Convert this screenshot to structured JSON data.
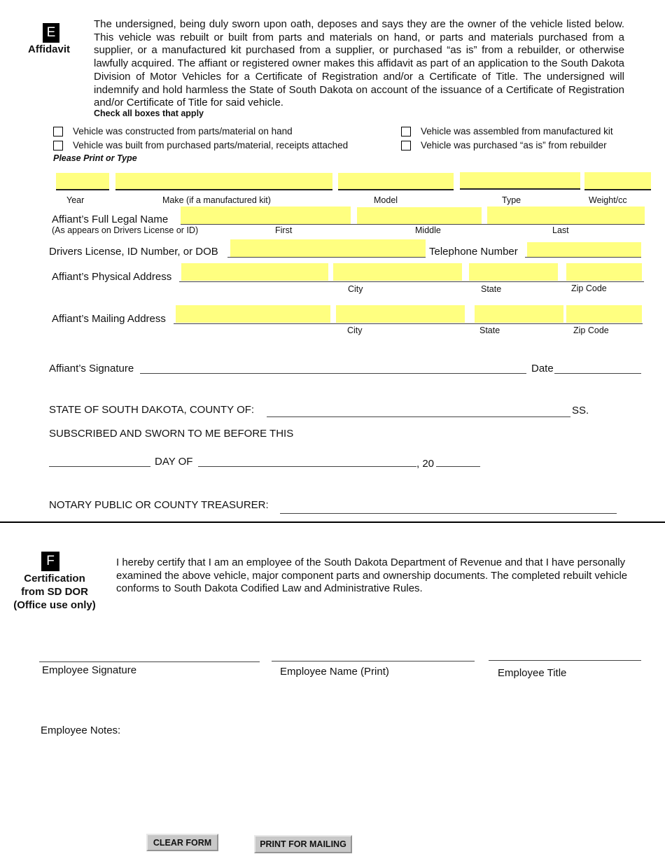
{
  "section_e": {
    "badge": "E",
    "title": "Affidavit",
    "paragraph": "The undersigned, being duly sworn upon oath, deposes and says they are the owner of the vehicle listed below. This vehicle was rebuilt or built from parts and materials on hand, or parts and materials purchased from a supplier, or a manufactured kit purchased from a supplier, or purchased “as is” from a rebuilder, or otherwise lawfully acquired.  The affiant or registered owner makes this affidavit as part of an application to the South Dakota Division of Motor Vehicles for a Certificate of Registration and/or a Certificate of Title. The undersigned will indemnify and hold harmless the State of South Dakota on account of the issuance of a Certificate of Registration and/or Certificate of Title for said vehicle.",
    "check_instruction": "Check all boxes that apply",
    "checkboxes": [
      {
        "label": "Vehicle was constructed from parts/material on hand",
        "checked": false
      },
      {
        "label": "Vehicle was built from purchased parts/material, receipts attached",
        "checked": false
      },
      {
        "label": "Vehicle was assembled from manufactured kit",
        "checked": false
      },
      {
        "label": "Vehicle was purchased “as is” from rebuilder",
        "checked": false
      }
    ],
    "print_instruction": "Please Print or Type"
  },
  "vehicle": {
    "year": {
      "label": "Year",
      "value": ""
    },
    "make": {
      "label": "Make (if a manufactured kit)",
      "value": ""
    },
    "model": {
      "label": "Model",
      "value": ""
    },
    "type": {
      "label": "Type",
      "value": ""
    },
    "weight": {
      "label": "Weight/cc",
      "value": ""
    }
  },
  "affiant": {
    "name_label": "Affiant’s Full Legal Name",
    "name_sublabel": "(As appears on Drivers License or ID)",
    "first": {
      "label": "First",
      "value": ""
    },
    "middle": {
      "label": "Middle",
      "value": ""
    },
    "last": {
      "label": "Last",
      "value": ""
    },
    "dl_label": "Drivers License, ID Number, or DOB",
    "dl_value": "",
    "phone_label": "Telephone Number",
    "phone_value": "",
    "physical": {
      "label": "Affiant’s Physical Address",
      "street": "",
      "city": "",
      "state": "",
      "zip": "",
      "city_label": "City",
      "state_label": "State",
      "zip_label": "Zip Code"
    },
    "mailing": {
      "label": "Affiant’s Mailing Address",
      "street": "",
      "city": "",
      "state": "",
      "zip": "",
      "city_label": "City",
      "state_label": "State",
      "zip_label": "Zip Code"
    },
    "signature_label": "Affiant’s Signature",
    "date_label": "Date"
  },
  "notary": {
    "county_label": "STATE OF SOUTH DAKOTA, COUNTY OF:",
    "ss": "SS.",
    "sworn_label": "SUBSCRIBED AND SWORN TO ME BEFORE THIS",
    "day_of": "DAY OF",
    "year_prefix": ", 20",
    "notary_label": "NOTARY PUBLIC OR COUNTY TREASURER:"
  },
  "section_f": {
    "badge": "F",
    "title_lines": [
      "Certification",
      "from SD DOR",
      "(Office use only)"
    ],
    "paragraph": "I hereby certify that I am an employee of the South Dakota Department of Revenue and that I have personally examined the above vehicle, major component parts and ownership documents. The completed rebuilt vehicle conforms to South Dakota Codified Law and Administrative Rules.",
    "employee_signature": "Employee Signature",
    "employee_name": "Employee Name (Print)",
    "employee_title": "Employee Title",
    "employee_notes": "Employee Notes:"
  },
  "buttons": {
    "clear": "CLEAR FORM",
    "print": "PRINT FOR MAILING"
  },
  "colors": {
    "field_fill": "#ffff80",
    "button_fill": "#c8c8c8"
  }
}
